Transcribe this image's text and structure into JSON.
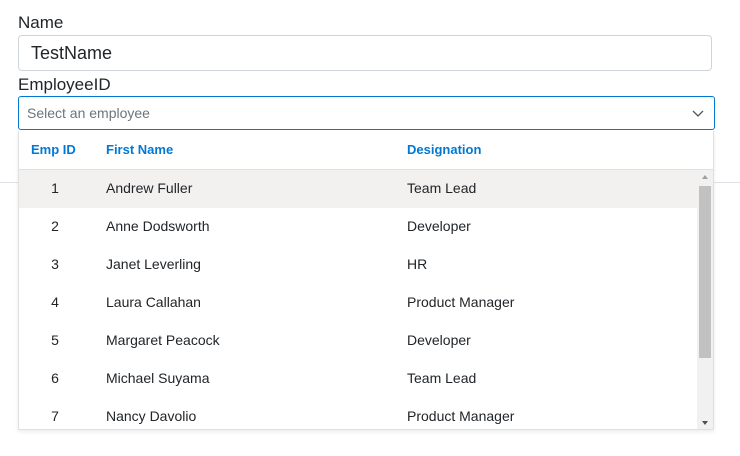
{
  "form": {
    "name_label": "Name",
    "name_value": "TestName",
    "employee_label": "EmployeeID",
    "employee_placeholder": "Select an employee"
  },
  "grid": {
    "headers": {
      "emp_id": "Emp ID",
      "first_name": "First Name",
      "designation": "Designation"
    },
    "rows": [
      {
        "id": "1",
        "first_name": "Andrew Fuller",
        "designation": "Team Lead"
      },
      {
        "id": "2",
        "first_name": "Anne Dodsworth",
        "designation": "Developer"
      },
      {
        "id": "3",
        "first_name": "Janet Leverling",
        "designation": "HR"
      },
      {
        "id": "4",
        "first_name": "Laura Callahan",
        "designation": "Product Manager"
      },
      {
        "id": "5",
        "first_name": "Margaret Peacock",
        "designation": "Developer"
      },
      {
        "id": "6",
        "first_name": "Michael Suyama",
        "designation": "Team Lead"
      },
      {
        "id": "7",
        "first_name": "Nancy Davolio",
        "designation": "Product Manager"
      }
    ]
  },
  "icons": {
    "dropdown": "chevron-down-icon",
    "scroll_up": "caret-up-icon",
    "scroll_down": "caret-down-icon"
  },
  "colors": {
    "accent": "#0078d4",
    "row_hover": "#f2f1f0",
    "border": "#ced4da"
  }
}
